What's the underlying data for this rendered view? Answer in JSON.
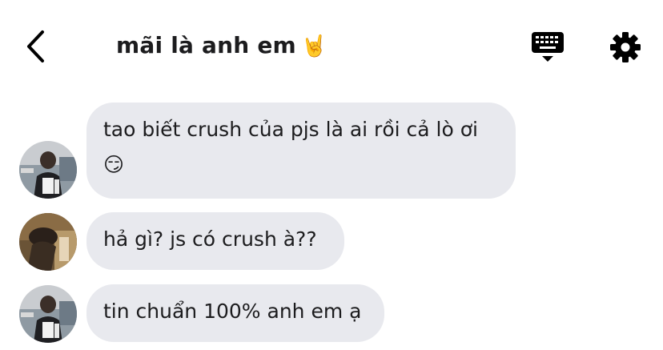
{
  "header": {
    "back_icon": "chevron-left-icon",
    "title": "mãi là anh em",
    "title_emoji": "🤘",
    "keyboard_icon": "keyboard-icon",
    "settings_icon": "gear-icon"
  },
  "messages": [
    {
      "text": "tao biết crush của pjs là ai rồi cả lò ơi",
      "emoji": "😏",
      "avatar": "avatar-1"
    },
    {
      "text": "hả gì? js có crush à??",
      "avatar": "avatar-2"
    },
    {
      "text": "tin chuẩn 100% anh em ạ",
      "avatar": "avatar-1"
    }
  ],
  "colors": {
    "bubble_bg": "#e8e9ee",
    "text": "#1c1c1e",
    "icon": "#000000"
  }
}
